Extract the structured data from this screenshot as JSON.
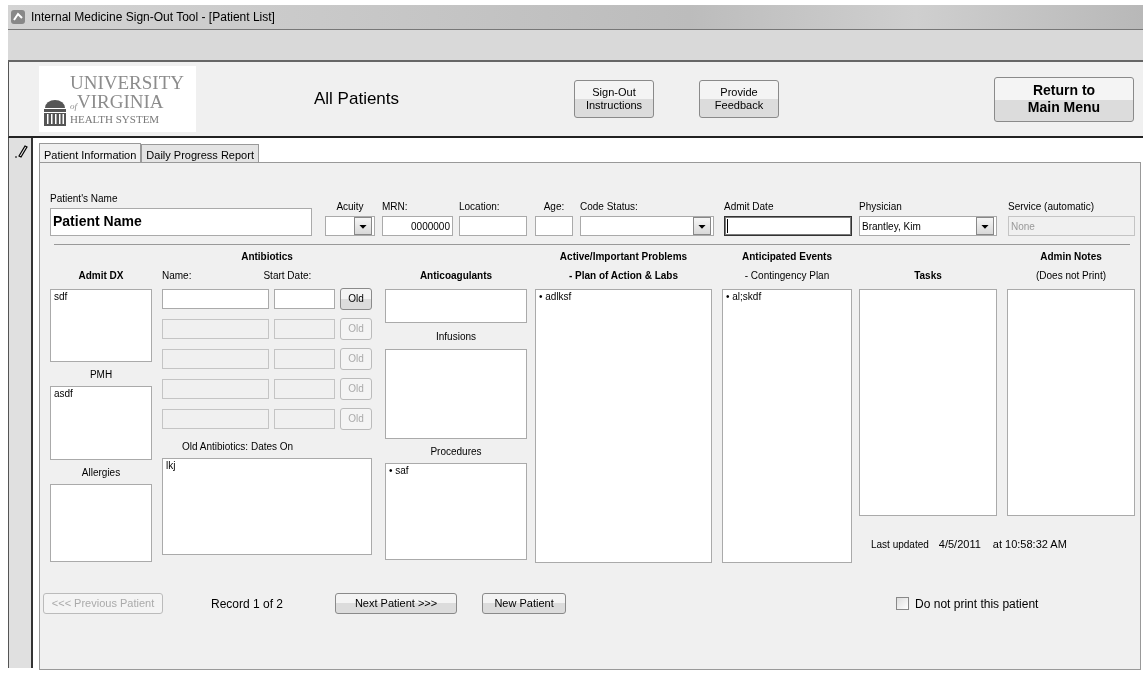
{
  "window": {
    "title": "Internal Medicine Sign-Out Tool - [Patient List]"
  },
  "header": {
    "logo": {
      "line1": "UNIVERSITY",
      "of": "of",
      "line2": "VIRGINIA",
      "line3": "HEALTH SYSTEM"
    },
    "title": "All Patients",
    "buttons": [
      {
        "label": "Sign-Out Instructions",
        "kind": "small"
      },
      {
        "label": "Provide Feedback",
        "kind": "small"
      },
      {
        "label": "Return to Main Menu",
        "kind": "large"
      }
    ]
  },
  "tabs": [
    {
      "label": "Patient Information",
      "selected": true
    },
    {
      "label": "Daily Progress Report",
      "selected": false
    }
  ],
  "patient_name": {
    "label": "Patient's Name",
    "value": "Patient Name"
  },
  "fields": [
    {
      "label": "Acuity",
      "kind": "combo",
      "disabled": false,
      "focused": false
    },
    {
      "label": "MRN:",
      "kind": "number",
      "value": "0000000",
      "disabled": false,
      "focused": false
    },
    {
      "label": "Location:",
      "kind": "text",
      "disabled": false,
      "focused": false
    },
    {
      "label": "Age:",
      "kind": "text",
      "disabled": false,
      "focused": false
    },
    {
      "label": "Code Status:",
      "kind": "combo",
      "disabled": false,
      "focused": false
    },
    {
      "label": "Admit Date",
      "kind": "text",
      "disabled": false,
      "focused": true
    },
    {
      "label": "Physician",
      "kind": "combo",
      "value": "Brantley, Kim",
      "disabled": false,
      "focused": false
    },
    {
      "label": "Service (automatic)",
      "kind": "text",
      "value": "None",
      "disabled": true,
      "focused": false
    }
  ],
  "admit_dx": {
    "heading": "Admit DX",
    "value": "sdf"
  },
  "pmh": {
    "heading": "PMH",
    "value": "asdf"
  },
  "allergies": {
    "heading": "Allergies"
  },
  "antibiotics": {
    "heading": "Antibiotics",
    "name_label": "Name:",
    "date_label": "Start Date:",
    "rows": [
      {
        "button": "Old",
        "disabled": false
      },
      {
        "button": "Old",
        "disabled": true
      },
      {
        "button": "Old",
        "disabled": true
      },
      {
        "button": "Old",
        "disabled": true
      },
      {
        "button": "Old",
        "disabled": true
      }
    ],
    "old_label": "Old Antibiotics: Dates On",
    "old_value": "lkj"
  },
  "anticoagulants": {
    "heading": "Anticoagulants"
  },
  "infusions": {
    "heading": "Infusions"
  },
  "procedures": {
    "heading": "Procedures",
    "value": "• saf"
  },
  "problems": {
    "heading": "Active/Important Problems",
    "subheading": "- Plan of Action & Labs",
    "subheading_bold": true,
    "value": "• adlksf"
  },
  "events": {
    "heading": "Anticipated Events",
    "subheading": "- Contingency Plan",
    "subheading_bold": false,
    "value": "• al;skdf"
  },
  "tasks": {
    "heading": "Tasks"
  },
  "admin_notes": {
    "heading": "Admin Notes",
    "subheading": "(Does not Print)",
    "subheading_bold": false
  },
  "last_updated": {
    "label": "Last updated",
    "date": "4/5/2011",
    "time": "at 10:58:32 AM"
  },
  "footer": {
    "previous": {
      "label": "<<< Previous Patient",
      "disabled": true
    },
    "record": "Record 1 of 2",
    "next": {
      "label": "Next Patient >>>",
      "disabled": false
    },
    "new": {
      "label": "New Patient",
      "disabled": false
    },
    "no_print": {
      "label": "Do not print this patient",
      "checked": false
    }
  }
}
